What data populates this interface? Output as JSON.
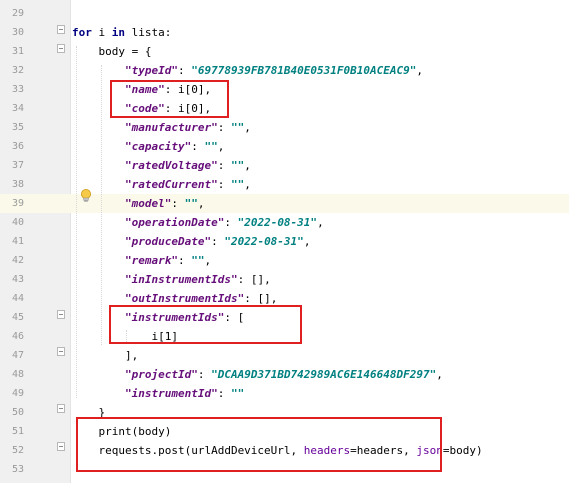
{
  "editor": {
    "lines": [
      {
        "num": "29",
        "tokens": []
      },
      {
        "num": "30",
        "tokens": [
          {
            "t": "for",
            "c": "kw"
          },
          {
            "t": " i ",
            "c": "plain"
          },
          {
            "t": "in",
            "c": "kw"
          },
          {
            "t": " lista:",
            "c": "plain"
          }
        ]
      },
      {
        "num": "31",
        "tokens": [
          {
            "t": "    body = {",
            "c": "plain"
          }
        ]
      },
      {
        "num": "32",
        "tokens": [
          {
            "t": "        ",
            "c": "plain"
          },
          {
            "t": "\"typeId\"",
            "c": "key"
          },
          {
            "t": ": ",
            "c": "plain"
          },
          {
            "t": "\"69778939FB781B40E0531F0B10ACEAC9\"",
            "c": "str"
          },
          {
            "t": ",",
            "c": "plain"
          }
        ]
      },
      {
        "num": "33",
        "tokens": [
          {
            "t": "        ",
            "c": "plain"
          },
          {
            "t": "\"name\"",
            "c": "key"
          },
          {
            "t": ": i[0],",
            "c": "plain"
          }
        ]
      },
      {
        "num": "34",
        "tokens": [
          {
            "t": "        ",
            "c": "plain"
          },
          {
            "t": "\"code\"",
            "c": "key"
          },
          {
            "t": ": i[0],",
            "c": "plain"
          }
        ]
      },
      {
        "num": "35",
        "tokens": [
          {
            "t": "        ",
            "c": "plain"
          },
          {
            "t": "\"manufacturer\"",
            "c": "key"
          },
          {
            "t": ": ",
            "c": "plain"
          },
          {
            "t": "\"\"",
            "c": "str"
          },
          {
            "t": ",",
            "c": "plain"
          }
        ]
      },
      {
        "num": "36",
        "tokens": [
          {
            "t": "        ",
            "c": "plain"
          },
          {
            "t": "\"capacity\"",
            "c": "key"
          },
          {
            "t": ": ",
            "c": "plain"
          },
          {
            "t": "\"\"",
            "c": "str"
          },
          {
            "t": ",",
            "c": "plain"
          }
        ]
      },
      {
        "num": "37",
        "tokens": [
          {
            "t": "        ",
            "c": "plain"
          },
          {
            "t": "\"ratedVoltage\"",
            "c": "key"
          },
          {
            "t": ": ",
            "c": "plain"
          },
          {
            "t": "\"\"",
            "c": "str"
          },
          {
            "t": ",",
            "c": "plain"
          }
        ]
      },
      {
        "num": "38",
        "tokens": [
          {
            "t": "        ",
            "c": "plain"
          },
          {
            "t": "\"ratedCurrent\"",
            "c": "key"
          },
          {
            "t": ": ",
            "c": "plain"
          },
          {
            "t": "\"\"",
            "c": "str"
          },
          {
            "t": ",",
            "c": "plain"
          }
        ]
      },
      {
        "num": "39",
        "tokens": [
          {
            "t": "        ",
            "c": "plain"
          },
          {
            "t": "\"model\"",
            "c": "key"
          },
          {
            "t": ": ",
            "c": "plain"
          },
          {
            "t": "\"\"",
            "c": "str"
          },
          {
            "t": ",",
            "c": "plain"
          }
        ]
      },
      {
        "num": "40",
        "tokens": [
          {
            "t": "        ",
            "c": "plain"
          },
          {
            "t": "\"operationDate\"",
            "c": "key"
          },
          {
            "t": ": ",
            "c": "plain"
          },
          {
            "t": "\"2022-08-31\"",
            "c": "str"
          },
          {
            "t": ",",
            "c": "plain"
          }
        ]
      },
      {
        "num": "41",
        "tokens": [
          {
            "t": "        ",
            "c": "plain"
          },
          {
            "t": "\"produceDate\"",
            "c": "key"
          },
          {
            "t": ": ",
            "c": "plain"
          },
          {
            "t": "\"2022-08-31\"",
            "c": "str"
          },
          {
            "t": ",",
            "c": "plain"
          }
        ]
      },
      {
        "num": "42",
        "tokens": [
          {
            "t": "        ",
            "c": "plain"
          },
          {
            "t": "\"remark\"",
            "c": "key"
          },
          {
            "t": ": ",
            "c": "plain"
          },
          {
            "t": "\"\"",
            "c": "str"
          },
          {
            "t": ",",
            "c": "plain"
          }
        ]
      },
      {
        "num": "43",
        "tokens": [
          {
            "t": "        ",
            "c": "plain"
          },
          {
            "t": "\"inInstrumentIds\"",
            "c": "key"
          },
          {
            "t": ": [],",
            "c": "plain"
          }
        ]
      },
      {
        "num": "44",
        "tokens": [
          {
            "t": "        ",
            "c": "plain"
          },
          {
            "t": "\"outInstrumentIds\"",
            "c": "key"
          },
          {
            "t": ": [],",
            "c": "plain"
          }
        ]
      },
      {
        "num": "45",
        "tokens": [
          {
            "t": "        ",
            "c": "plain"
          },
          {
            "t": "\"instrumentIds\"",
            "c": "key"
          },
          {
            "t": ": [",
            "c": "plain"
          }
        ]
      },
      {
        "num": "46",
        "tokens": [
          {
            "t": "            i[1]",
            "c": "plain"
          }
        ]
      },
      {
        "num": "47",
        "tokens": [
          {
            "t": "        ],",
            "c": "plain"
          }
        ]
      },
      {
        "num": "48",
        "tokens": [
          {
            "t": "        ",
            "c": "plain"
          },
          {
            "t": "\"projectId\"",
            "c": "key"
          },
          {
            "t": ": ",
            "c": "plain"
          },
          {
            "t": "\"DCAA9D371BD742989AC6E146648DF297\"",
            "c": "str"
          },
          {
            "t": ",",
            "c": "plain"
          }
        ]
      },
      {
        "num": "49",
        "tokens": [
          {
            "t": "        ",
            "c": "plain"
          },
          {
            "t": "\"instrumentId\"",
            "c": "key"
          },
          {
            "t": ": ",
            "c": "plain"
          },
          {
            "t": "\"\"",
            "c": "str"
          }
        ]
      },
      {
        "num": "50",
        "tokens": [
          {
            "t": "    }",
            "c": "plain"
          }
        ]
      },
      {
        "num": "51",
        "tokens": [
          {
            "t": "    print(body)",
            "c": "plain"
          }
        ]
      },
      {
        "num": "52",
        "tokens": [
          {
            "t": "    requests.post(urlAddDeviceUrl, ",
            "c": "plain"
          },
          {
            "t": "headers",
            "c": "kwarg"
          },
          {
            "t": "=headers, ",
            "c": "plain"
          },
          {
            "t": "json",
            "c": "kwarg"
          },
          {
            "t": "=body)",
            "c": "plain"
          }
        ]
      },
      {
        "num": "53",
        "tokens": []
      }
    ],
    "highlighted_line": "39",
    "icons": {
      "bulb": "lightbulb-icon",
      "fold": "fold-marker-icon"
    },
    "colors": {
      "annotation_box": "#e02020",
      "keyword": "#000080",
      "string": "#008080",
      "key": "#660e7a"
    }
  }
}
